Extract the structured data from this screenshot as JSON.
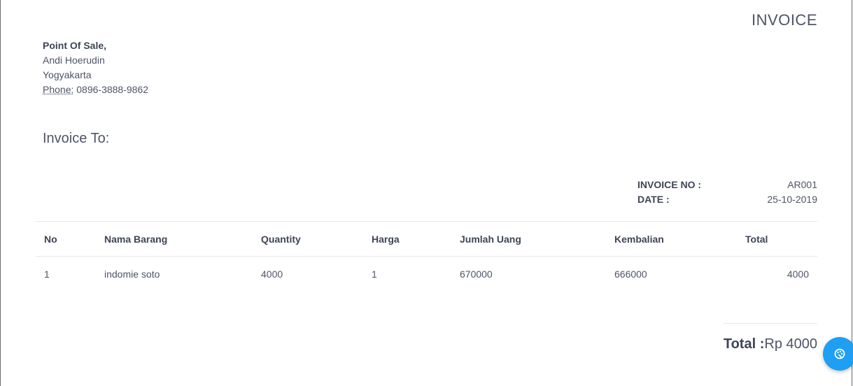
{
  "header": {
    "title": "INVOICE"
  },
  "company": {
    "name": "Point Of Sale,",
    "owner": "Andi Hoerudin",
    "city": "Yogyakarta",
    "phone_label": "Phone:",
    "phone": "0896-3888-9862"
  },
  "invoice_to_label": "Invoice To:",
  "meta": {
    "invoice_no_label": "INVOICE NO :",
    "invoice_no": "AR001",
    "date_label": "DATE :",
    "date": "25-10-2019"
  },
  "table": {
    "columns": [
      "No",
      "Nama Barang",
      "Quantity",
      "Harga",
      "Jumlah Uang",
      "Kembalian",
      "Total"
    ],
    "rows": [
      [
        "1",
        "indomie soto",
        "4000",
        "1",
        "670000",
        "666000",
        "4000"
      ]
    ]
  },
  "summary": {
    "total_label": "Total :",
    "total_value": "Rp 4000"
  },
  "fab": {
    "icon": "palette-icon",
    "color": "#1e9ff2"
  }
}
